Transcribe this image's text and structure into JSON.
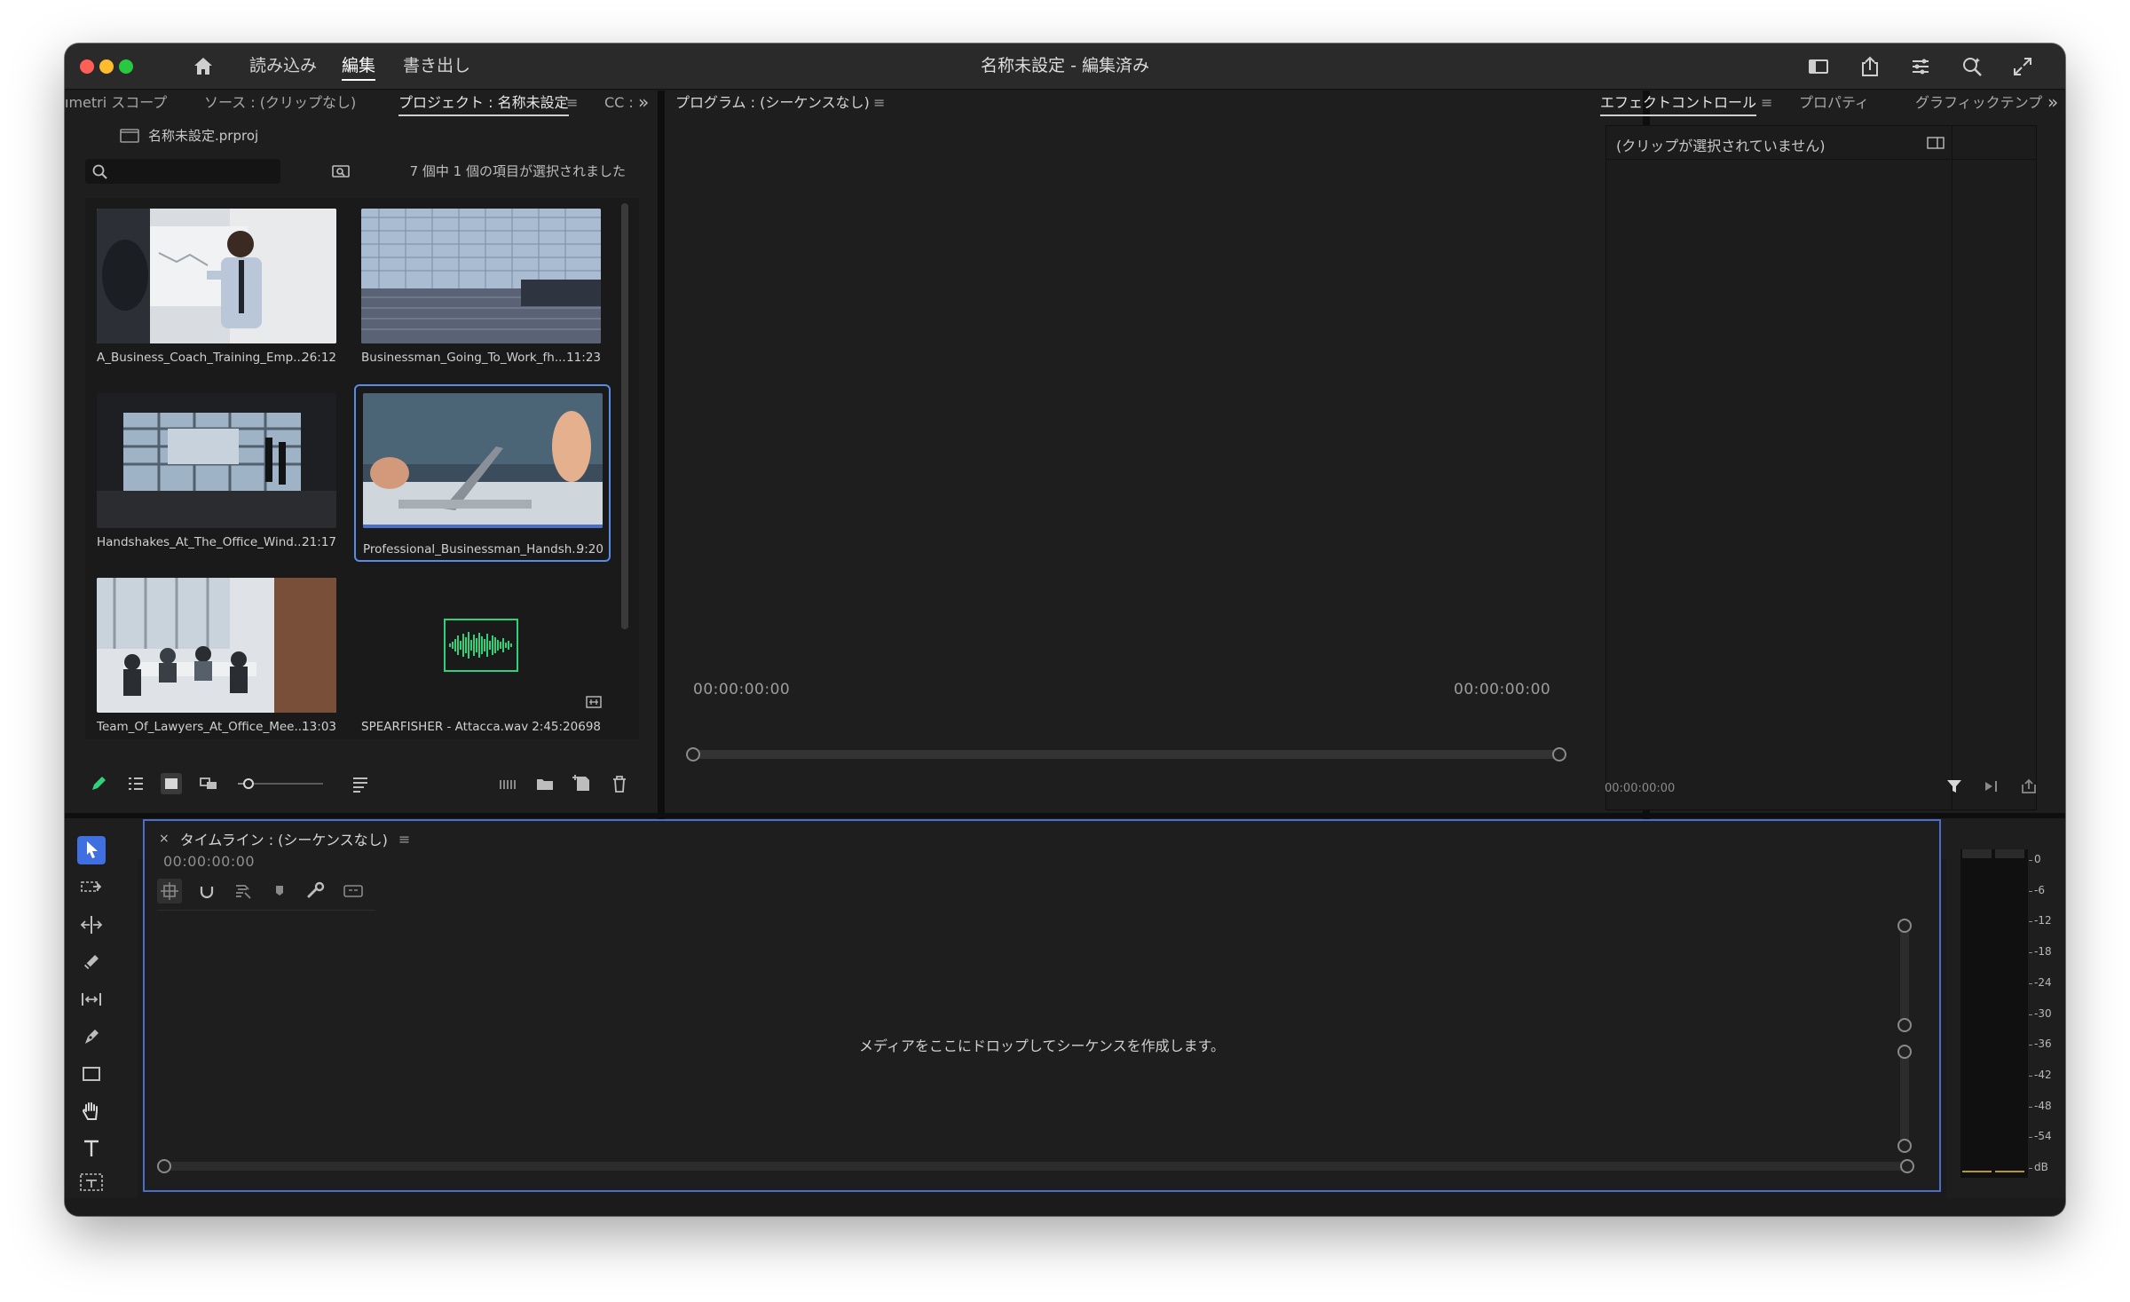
{
  "window": {
    "title": "名称未設定 - 編集済み",
    "workspace_tabs": [
      {
        "label": "読み込み",
        "active": false
      },
      {
        "label": "編集",
        "active": true
      },
      {
        "label": "書き出し",
        "active": false
      }
    ],
    "toolbar_icons": [
      "workspace-icon",
      "share-icon",
      "quick-actions-icon",
      "search-help-icon",
      "fullscreen-icon"
    ]
  },
  "project_panel": {
    "tabs": [
      {
        "label": "ımetri スコープ",
        "active": false
      },
      {
        "label": "ソース : (クリップなし)",
        "active": false
      },
      {
        "label": "プロジェクト : 名称未設定",
        "active": true
      },
      {
        "label": "CC :",
        "active": false
      }
    ],
    "menu_glyph": "≡",
    "overflow": "»",
    "project_file": "名称未設定.prproj",
    "search_placeholder": "",
    "selection_status": "7 個中 1 個の項目が選択されました",
    "clips": [
      {
        "name": "A_Business_Coach_Training_Emp...",
        "duration": "26:12",
        "selected": false
      },
      {
        "name": "Businessman_Going_To_Work_fh...",
        "duration": "11:23",
        "selected": false
      },
      {
        "name": "Handshakes_At_The_Office_Wind...",
        "duration": "21:17",
        "selected": false
      },
      {
        "name": "Professional_Businessman_Handsh...",
        "duration": "9:20",
        "selected": true
      },
      {
        "name": "Team_Of_Lawyers_At_Office_Mee...",
        "duration": "13:03",
        "selected": false
      },
      {
        "name": "SPEARFISHER - Attacca.wav",
        "duration": "2:45:20698",
        "selected": false
      }
    ]
  },
  "program_monitor": {
    "tab": "プログラム : (シーケンスなし)",
    "menu_glyph": "≡",
    "timecode_left": "00:00:00:00",
    "timecode_right": "00:00:00:00"
  },
  "effect_controls": {
    "tabs": [
      {
        "label": "エフェクトコントロール",
        "active": true
      },
      {
        "label": "プロパティ",
        "active": false
      },
      {
        "label": "グラフィックテンプ",
        "active": false
      }
    ],
    "menu_glyph": "≡",
    "overflow": "»",
    "empty_message": "(クリップが選択されていません)",
    "timecode": "00:00:00:00"
  },
  "timeline": {
    "close": "×",
    "title": "タイムライン : (シーケンスなし)",
    "menu_glyph": "≡",
    "timecode": "00:00:00:00",
    "drop_hint": "メディアをここにドロップしてシーケンスを作成します。"
  },
  "audio_meter": {
    "scale": [
      "0",
      "-6",
      "-12",
      "-18",
      "-24",
      "-30",
      "-36",
      "-42",
      "-48",
      "-54",
      "dB"
    ]
  },
  "colors": {
    "accent_blue": "#4b6fc9",
    "selected_tool": "#3f6fe0",
    "waveform_green": "#2fd17a",
    "close": "#ff5f57",
    "minimize": "#febc2e",
    "zoom": "#28c840"
  }
}
